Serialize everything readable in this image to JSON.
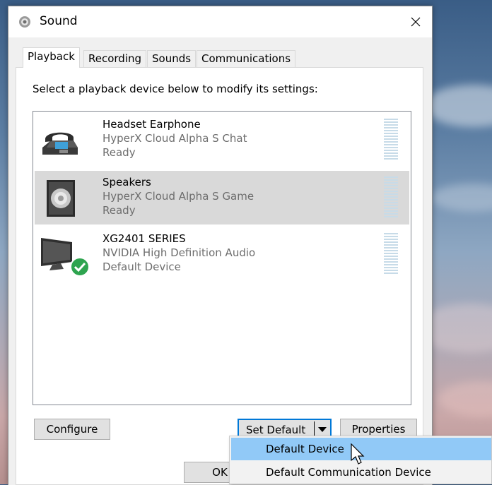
{
  "window": {
    "title": "Sound",
    "close_label": "×"
  },
  "tabs": [
    {
      "label": "Playback",
      "active": true
    },
    {
      "label": "Recording",
      "active": false
    },
    {
      "label": "Sounds",
      "active": false
    },
    {
      "label": "Communications",
      "active": false
    }
  ],
  "panel": {
    "instruction": "Select a playback device below to modify its settings:"
  },
  "devices": [
    {
      "name": "Headset Earphone",
      "description": "HyperX Cloud Alpha S Chat",
      "status": "Ready",
      "icon": "headset-phone-icon",
      "selected": false,
      "default": false
    },
    {
      "name": "Speakers",
      "description": "HyperX Cloud Alpha S Game",
      "status": "Ready",
      "icon": "speaker-icon",
      "selected": true,
      "default": false
    },
    {
      "name": "XG2401 SERIES",
      "description": "NVIDIA High Definition Audio",
      "status": "Default Device",
      "icon": "monitor-icon",
      "selected": false,
      "default": true
    }
  ],
  "buttons": {
    "configure": "Configure",
    "set_default": "Set Default",
    "properties": "Properties",
    "ok": "OK"
  },
  "dropdown_menu": {
    "items": [
      {
        "label": "Default Device",
        "hovered": true
      },
      {
        "label": "Default Communication Device",
        "hovered": false
      }
    ]
  },
  "colors": {
    "selection": "#d9d9d9",
    "menu_hover": "#91c9f7",
    "focus_border": "#0078d7",
    "default_badge": "#2ea44f"
  }
}
